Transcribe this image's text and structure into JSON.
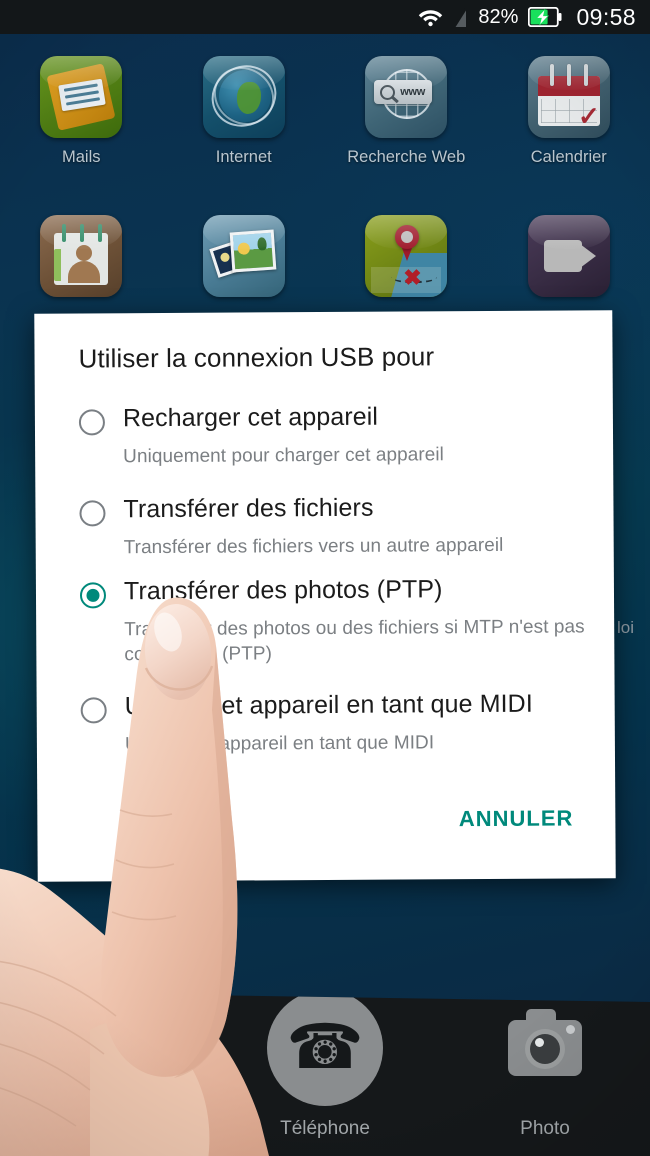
{
  "statusbar": {
    "wifi_icon": "wifi-icon",
    "signal_icon": "signal-off-icon",
    "battery_percent": "82%",
    "battery_icon": "battery-charging-icon",
    "clock": "09:58"
  },
  "home": {
    "rows": [
      [
        {
          "label": "Mails",
          "icon": "mail-app-icon"
        },
        {
          "label": "Internet",
          "icon": "browser-globe-app-icon"
        },
        {
          "label": "Recherche Web",
          "icon": "web-search-app-icon"
        },
        {
          "label": "Calendrier",
          "icon": "calendar-app-icon"
        }
      ],
      [
        {
          "label": "",
          "icon": "contacts-app-icon"
        },
        {
          "label": "",
          "icon": "gallery-app-icon"
        },
        {
          "label": "",
          "icon": "maps-app-icon"
        },
        {
          "label": "",
          "icon": "video-camera-app-icon"
        }
      ]
    ],
    "partial_label": "loi"
  },
  "dialog": {
    "title": "Utiliser la connexion USB pour",
    "options": [
      {
        "title": "Recharger cet appareil",
        "subtitle": "Uniquement pour charger cet appareil",
        "selected": false
      },
      {
        "title": "Transférer des fichiers",
        "subtitle": "Transférer des fichiers vers un autre appareil",
        "selected": false
      },
      {
        "title": "Transférer des photos (PTP)",
        "subtitle": "Transférer des photos ou des fichiers si MTP n'est pas compatible (PTP)",
        "selected": true
      },
      {
        "title": "Utiliser cet appareil en tant que MIDI",
        "subtitle": "Utiliser cet appareil en tant que MIDI",
        "selected": false
      }
    ],
    "cancel_label": "ANNULER",
    "accent_color": "#00897b"
  },
  "dock": {
    "items": [
      {
        "label": "Téléphone",
        "icon": "phone-icon"
      },
      {
        "label": "Photo",
        "icon": "camera-icon"
      }
    ]
  }
}
